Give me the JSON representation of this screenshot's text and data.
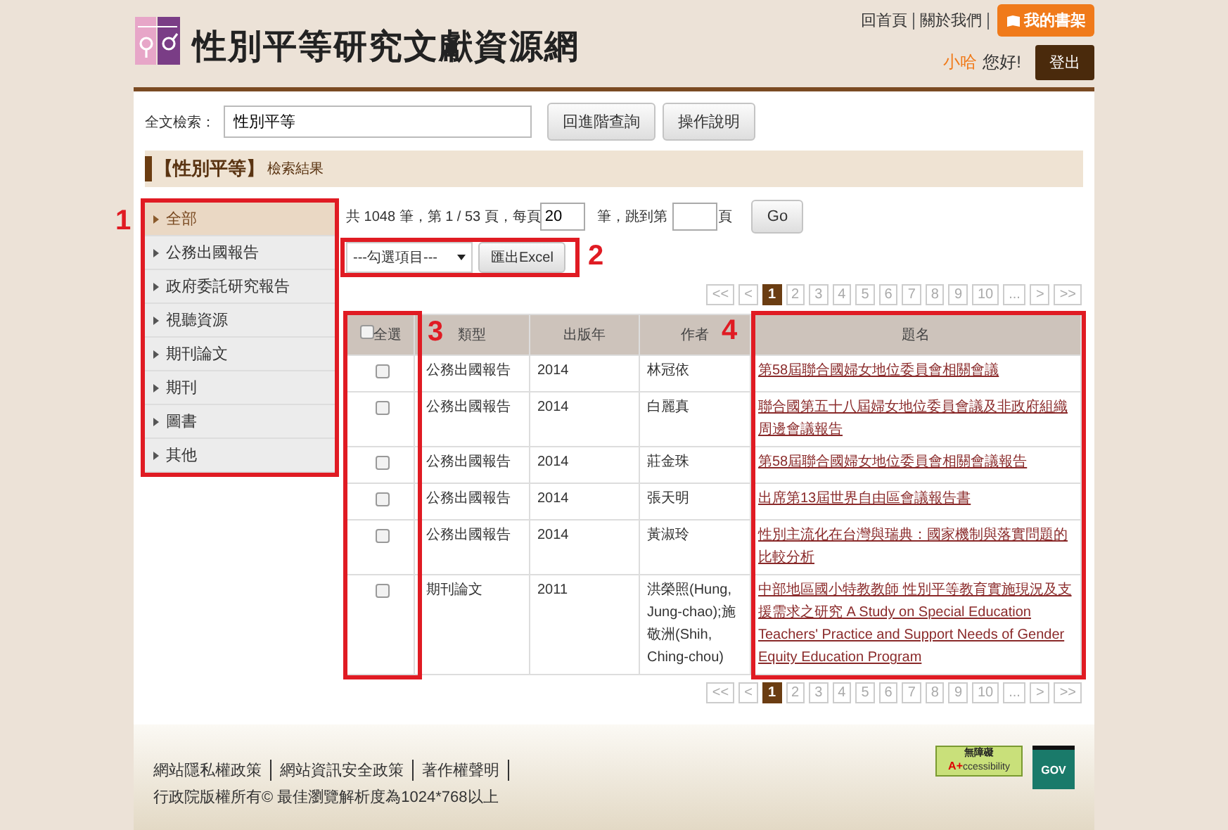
{
  "header": {
    "site_title": "性別平等研究文獻資源網",
    "links": [
      "回首頁",
      "關於我們"
    ],
    "bookshelf_button": "我的書架",
    "user_name": "小哈",
    "greeting": "您好!",
    "logout_button": "登出"
  },
  "search": {
    "label": "全文檢索：",
    "value": "性別平等",
    "buttons": [
      "回進階查詢",
      "操作說明"
    ]
  },
  "result_banner": {
    "keyword": "【性別平等】",
    "label": "檢索結果"
  },
  "sidebar": {
    "items": [
      {
        "label": "全部",
        "selected": true
      },
      {
        "label": "公務出國報告",
        "selected": false
      },
      {
        "label": "政府委託研究報告",
        "selected": false
      },
      {
        "label": "視聽資源",
        "selected": false
      },
      {
        "label": "期刊論文",
        "selected": false
      },
      {
        "label": "期刊",
        "selected": false
      },
      {
        "label": "圖書",
        "selected": false
      },
      {
        "label": "其他",
        "selected": false
      }
    ]
  },
  "summary": {
    "total": "共 1048 筆，第 1 / 53 頁，",
    "per_page_label": "每頁",
    "per_page": "20",
    "jump_label": "筆，跳到第",
    "page_suffix": "頁",
    "go_button": "Go"
  },
  "export": {
    "select": "---勾選項目---",
    "button": "匯出Excel"
  },
  "paginations": [
    {
      "pages": [
        {
          "label": "<<",
          "selected": false
        },
        {
          "label": "<",
          "selected": false
        },
        {
          "label": "1",
          "selected": true
        },
        {
          "label": "2",
          "selected": false
        },
        {
          "label": "3",
          "selected": false
        },
        {
          "label": "4",
          "selected": false
        },
        {
          "label": "5",
          "selected": false
        },
        {
          "label": "6",
          "selected": false
        },
        {
          "label": "7",
          "selected": false
        },
        {
          "label": "8",
          "selected": false
        },
        {
          "label": "9",
          "selected": false
        },
        {
          "label": "10",
          "selected": false
        },
        {
          "label": "...",
          "selected": false
        },
        {
          "label": ">",
          "selected": false
        },
        {
          "label": ">>",
          "selected": false
        }
      ]
    },
    {
      "pages": [
        {
          "label": "<<",
          "selected": false
        },
        {
          "label": "<",
          "selected": false
        },
        {
          "label": "1",
          "selected": true
        },
        {
          "label": "2",
          "selected": false
        },
        {
          "label": "3",
          "selected": false
        },
        {
          "label": "4",
          "selected": false
        },
        {
          "label": "5",
          "selected": false
        },
        {
          "label": "6",
          "selected": false
        },
        {
          "label": "7",
          "selected": false
        },
        {
          "label": "8",
          "selected": false
        },
        {
          "label": "9",
          "selected": false
        },
        {
          "label": "10",
          "selected": false
        },
        {
          "label": "...",
          "selected": false
        },
        {
          "label": ">",
          "selected": false
        },
        {
          "label": ">>",
          "selected": false
        }
      ]
    }
  ],
  "table": {
    "select_all": {
      "label": "全選",
      "checked": false
    },
    "columns": [
      "類型",
      "出版年",
      "作者",
      "題名"
    ],
    "rows": [
      {
        "checked": false,
        "type": "公務出國報告",
        "year": "2014",
        "author": "林冠依",
        "title": "第58屆聯合國婦女地位委員會相關會議"
      },
      {
        "checked": false,
        "type": "公務出國報告",
        "year": "2014",
        "author": "白麗真",
        "title": "聯合國第五十八屆婦女地位委員會議及非政府組織周邊會議報告"
      },
      {
        "checked": false,
        "type": "公務出國報告",
        "year": "2014",
        "author": "莊金珠",
        "title": "第58屆聯合國婦女地位委員會相關會議報告"
      },
      {
        "checked": false,
        "type": "公務出國報告",
        "year": "2014",
        "author": "張天明",
        "title": "出席第13屆世界自由區會議報告書"
      },
      {
        "checked": false,
        "type": "公務出國報告",
        "year": "2014",
        "author": "黃淑玲",
        "title": "性別主流化在台灣與瑞典：國家機制與落實問題的比較分析"
      },
      {
        "checked": false,
        "type": "期刊論文",
        "year": "2011",
        "author": "洪榮照(Hung, Jung-chao);施敬洲(Shih, Ching-chou)",
        "title": "中部地區國小特教教師 性別平等教育實施現況及支援需求之研究 A Study on Special Education Teachers' Practice and Support Needs of Gender Equity Education Program"
      }
    ]
  },
  "annotations": [
    {
      "label": "1"
    },
    {
      "label": "2"
    },
    {
      "label": "3"
    },
    {
      "label": "4"
    }
  ],
  "footer": {
    "links": [
      "網站隱私權政策",
      "網站資訊安全政策",
      "著作權聲明"
    ],
    "copyright": "行政院版權所有© 最佳瀏覽解析度為1024*768以上",
    "accessibility_badge": {
      "title": "無障礙",
      "grade": "A+",
      "caption": "ccessibility"
    },
    "gov_badge": "GOV"
  }
}
